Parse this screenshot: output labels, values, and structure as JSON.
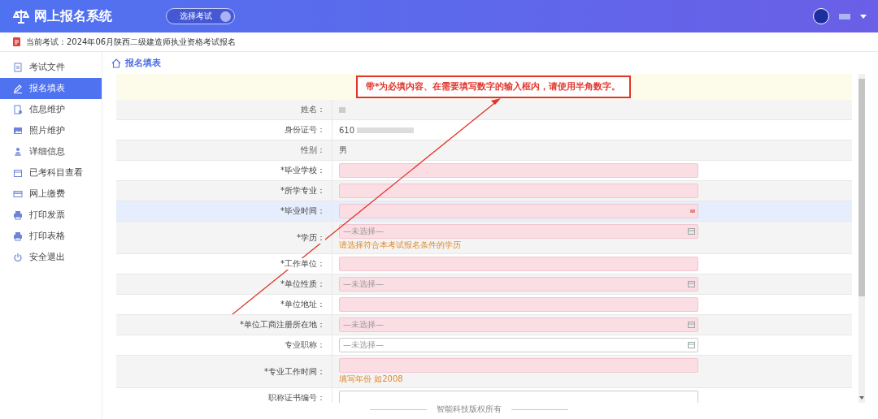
{
  "header": {
    "title": "网上报名系统",
    "exam_button": "选择考试"
  },
  "current_exam": "当前考试：2024年06月陕西二级建造师执业资格考试报名",
  "sidebar": {
    "items": [
      {
        "label": "考试文件",
        "selected": false
      },
      {
        "label": "报名填表",
        "selected": true
      },
      {
        "label": "信息维护",
        "selected": false
      },
      {
        "label": "照片维护",
        "selected": false
      },
      {
        "label": "详细信息",
        "selected": false
      },
      {
        "label": "已考科目查看",
        "selected": false
      },
      {
        "label": "网上缴费",
        "selected": false
      },
      {
        "label": "打印发票",
        "selected": false
      },
      {
        "label": "打印表格",
        "selected": false
      },
      {
        "label": "安全退出",
        "selected": false
      }
    ]
  },
  "page_title": "报名填表",
  "notice": "带*为必填内容、在需要填写数字的输入框内，请使用半角数字。",
  "form": {
    "rows": [
      {
        "label": "姓名：",
        "required": false,
        "kind": "static",
        "redacted": true,
        "highlighted": false
      },
      {
        "label": "身份证号：",
        "required": false,
        "kind": "static",
        "value": "610",
        "redacted": true,
        "highlighted": false
      },
      {
        "label": "性别：",
        "required": false,
        "kind": "static",
        "value": "男",
        "highlighted": false
      },
      {
        "label": "*毕业学校：",
        "required": true,
        "kind": "input",
        "highlighted": false
      },
      {
        "label": "*所学专业：",
        "required": true,
        "kind": "input",
        "highlighted": false
      },
      {
        "label": "*毕业时间：",
        "required": true,
        "kind": "date",
        "highlighted": true
      },
      {
        "label": "*学历：",
        "required": true,
        "kind": "select",
        "placeholder": "—未选择—",
        "hint": "请选择符合本考试报名条件的学历",
        "highlighted": false
      },
      {
        "label": "*工作单位：",
        "required": true,
        "kind": "input",
        "highlighted": false
      },
      {
        "label": "*单位性质：",
        "required": true,
        "kind": "select",
        "placeholder": "—未选择—",
        "highlighted": false
      },
      {
        "label": "*单位地址：",
        "required": true,
        "kind": "input",
        "highlighted": false
      },
      {
        "label": "*单位工商注册所在地：",
        "required": true,
        "kind": "select",
        "placeholder": "—未选择—",
        "highlighted": false
      },
      {
        "label": "专业职称：",
        "required": false,
        "kind": "select",
        "placeholder": "—未选择—",
        "highlighted": false
      },
      {
        "label": "*专业工作时间：",
        "required": true,
        "kind": "input",
        "hint": "填写年份 如2008",
        "highlighted": false
      },
      {
        "label": "职称证书编号：",
        "required": false,
        "kind": "input",
        "highlighted": false
      }
    ]
  },
  "footer": "智能科技版权所有"
}
